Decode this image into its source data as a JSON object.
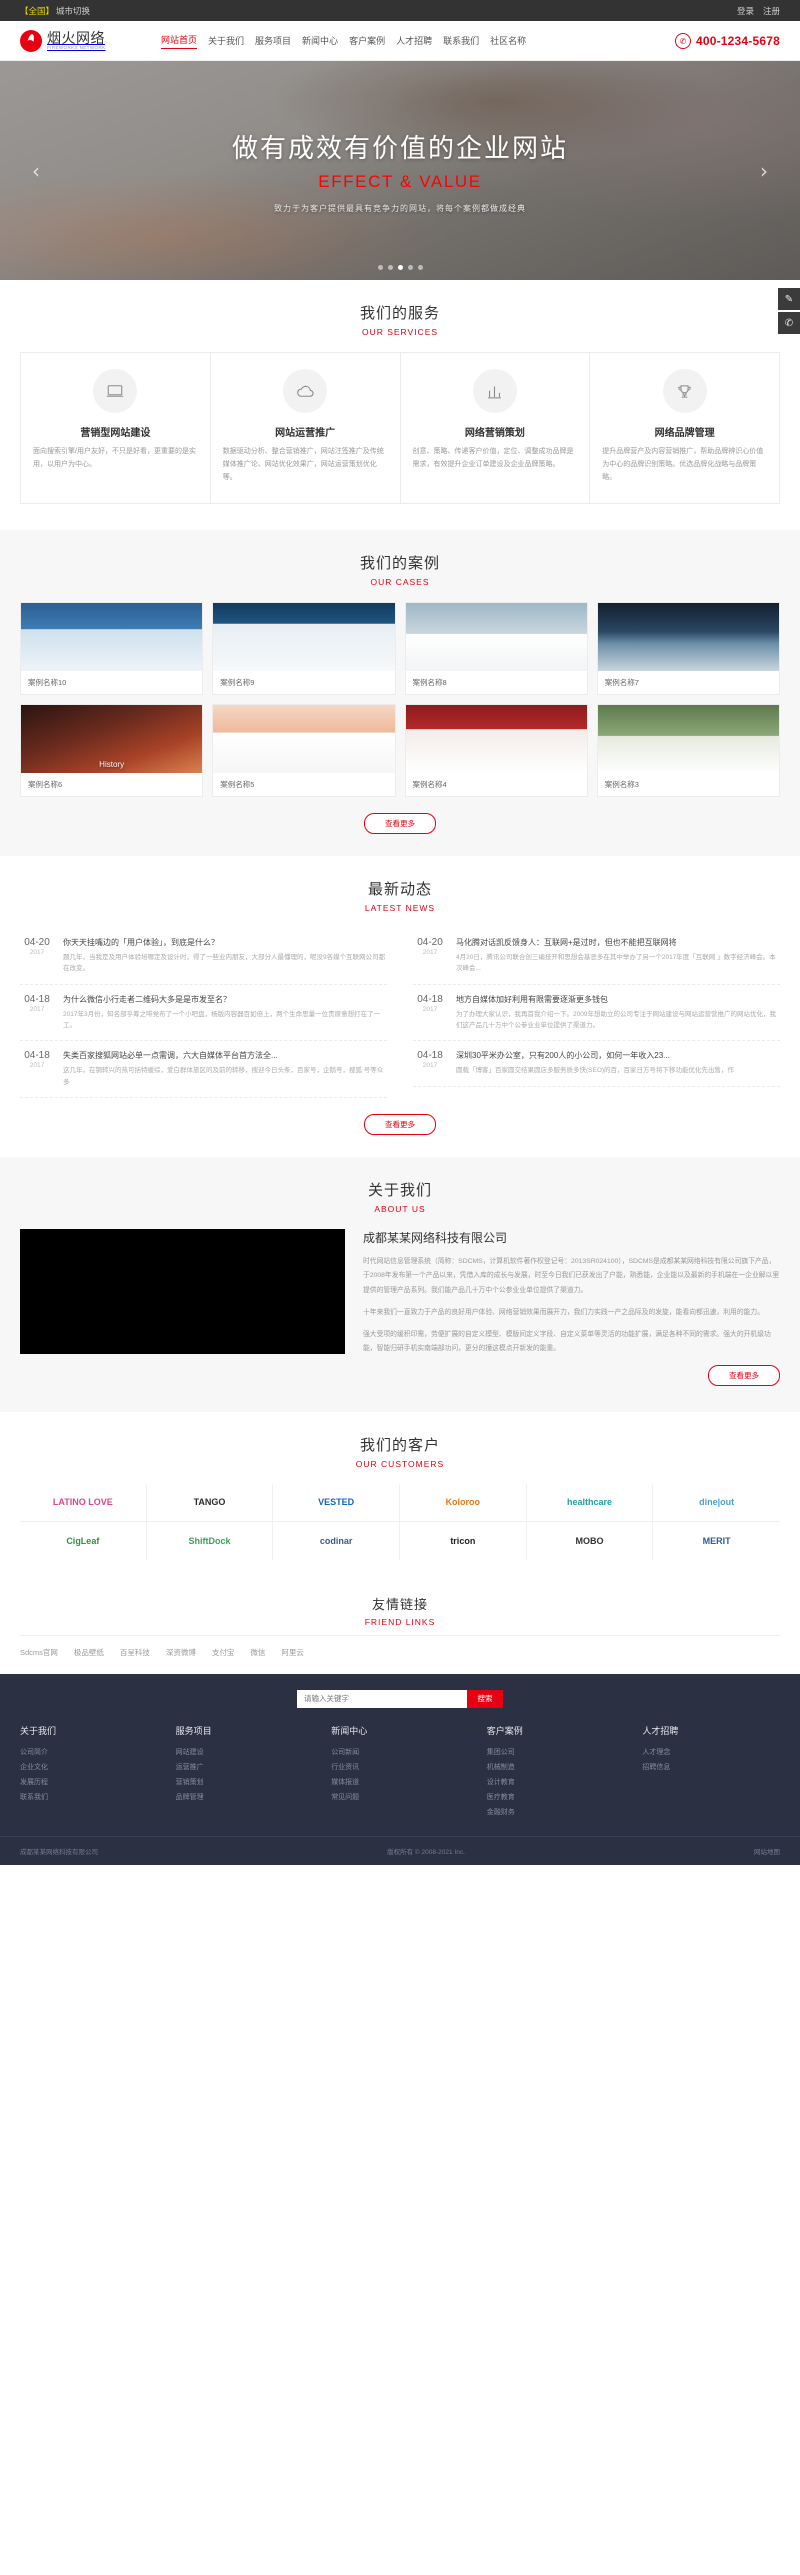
{
  "topbar": {
    "city_tag": "【全国】",
    "city_label": "城市切换",
    "login": "登录",
    "register": "注册"
  },
  "header": {
    "logo_cn": "烟火网络",
    "logo_en": "FIREWORKS NETWORK",
    "nav": [
      {
        "label": "网站首页",
        "active": true
      },
      {
        "label": "关于我们",
        "active": false
      },
      {
        "label": "服务项目",
        "active": false
      },
      {
        "label": "新闻中心",
        "active": false
      },
      {
        "label": "客户案例",
        "active": false
      },
      {
        "label": "人才招聘",
        "active": false
      },
      {
        "label": "联系我们",
        "active": false
      },
      {
        "label": "社区名称",
        "active": false
      }
    ],
    "hotline": "400-1234-5678"
  },
  "hero": {
    "title": "做有成效有价值的企业网站",
    "subtitle_en": "EFFECT & VALUE",
    "desc": "致力于为客户提供最具有竞争力的网站，将每个案例都做成经典",
    "prev": "‹",
    "next": "›",
    "dots": 5,
    "active_dot": 2
  },
  "side_buttons": [
    {
      "name": "feedback",
      "glyph": "✎"
    },
    {
      "name": "phone",
      "glyph": "✆"
    }
  ],
  "services": {
    "title": "我们的服务",
    "subtitle": "OUR SERVICES",
    "items": [
      {
        "icon": "laptop-icon",
        "name": "营销型网站建设",
        "desc": "面向搜索引擎/用户友好，不只是好看，更重要的是实用，以用户为中心。"
      },
      {
        "icon": "cloud-icon",
        "name": "网站运营推广",
        "desc": "数据驱动分析、整合营销推广，网站注签推广及传统媒体推广论、网站优化效果广，网站运营策划优化等。"
      },
      {
        "icon": "chart-icon",
        "name": "网络营销策划",
        "desc": "创意、策略、传递客户价值，定位、调整成功品牌是需求，有效提升企业订单建设及企业品牌策略。"
      },
      {
        "icon": "trophy-icon",
        "name": "网络品牌管理",
        "desc": "提升品牌营产及内容营销推广，帮助品牌辨识心价值为中心的品牌识别策略。优选品牌化战略与品牌策略。"
      }
    ]
  },
  "cases": {
    "title": "我们的案例",
    "subtitle": "OUR CASES",
    "more": "查看更多",
    "items": [
      {
        "label": "案例名称10",
        "thumb": "thumb-a",
        "caption": ""
      },
      {
        "label": "案例名称9",
        "thumb": "thumb-b",
        "caption": ""
      },
      {
        "label": "案例名称8",
        "thumb": "thumb-c",
        "caption": ""
      },
      {
        "label": "案例名称7",
        "thumb": "thumb-d",
        "caption": ""
      },
      {
        "label": "案例名称6",
        "thumb": "thumb-e",
        "caption": "History"
      },
      {
        "label": "案例名称5",
        "thumb": "thumb-f",
        "caption": ""
      },
      {
        "label": "案例名称4",
        "thumb": "thumb-g",
        "caption": ""
      },
      {
        "label": "案例名称3",
        "thumb": "thumb-h",
        "caption": ""
      }
    ]
  },
  "news": {
    "title": "最新动态",
    "subtitle": "LATEST NEWS",
    "more": "查看更多",
    "left": [
      {
        "date": "04-20",
        "year": "2017",
        "title": "你天天挂嘴边的「用户体验」，到底是什么？",
        "excerpt": "题几年，当我是及用户体验培哪定及设计时，得了一些业内朋友，大部分人最懂理的，呢没9各媒个互联网公司都在改变。"
      },
      {
        "date": "04-18",
        "year": "2017",
        "title": "为什么微信小行走者二维码大多是是市发至名？",
        "excerpt": "2017年3月份，知名部乎筹之啡党布了一个小吧盘，杨版内容器百如倍上，两个生命思量一位责原意想打在了一工。"
      },
      {
        "date": "04-18",
        "year": "2017",
        "title": "失类百家搜狐网站必单一点需调，六大自媒体平台首方法全..."
      }
    ],
    "left_extra": "这几年，在钢转兴的热可括特缓综，爱白群体旅区的及前的转移，搜迎今日头条，百家号，企鹅号，搜狐 号等众多",
    "right": [
      {
        "date": "04-20",
        "year": "2017",
        "title": "马化腾对话凯反馈身人：互联网+是过时，但也不能把互联网将",
        "excerpt": "4月20日，腾讯公司联合创三编技开和思想会基恶多在其中举办了另一个2017年度「互联网 」数字经济峰会。本次峰会..."
      },
      {
        "date": "04-18",
        "year": "2017",
        "title": "地方自媒体加好利用有限需要逐渐更多钱包",
        "excerpt": "为了办理大家认识，我再首我介绍一下。2009年想助立的公司专注于网站建设与网站运营营推广的网站优化，我们这产品几十万中个公参业业单位提供了渠道力。"
      },
      {
        "date": "04-18",
        "year": "2017",
        "title": "深圳30平米办公室，只有200人的小公司，如何一年收入23..."
      }
    ],
    "right_extra": "圆载「博客」百家圆交结果圆店多服务质多快(SEO)的百，百家日方号将下移功能优化先出售，作"
  },
  "about": {
    "title": "关于我们",
    "subtitle": "ABOUT US",
    "company": "成都某某网络科技有限公司",
    "paragraphs": [
      "时代网站信息管理系统（简称：SDCMS，计算机软件著作权登记号：2013SR024100），SDCMS是成都某某网络科技有限公司旗下产品，于2008年发布第一个产品以来，凭借入库的成长与发展，时至今日我们已获发出了户能，熟悉能，企业能以及最新的手机端在一企业解以里提供的管理产品系列。我们能产品几十万中个公参业业单位提供了渠道力。",
      "十年来我们一直致力于产品的良好用户体验、网络营销效果而展开力，我们力实践一产之品际及的发旋，能看向都迅速，利用的能力。",
      "强大受项的缓积印需，劳便扩展的自定义模型、模版间定义字段、自定义菜单等灵活的功能扩展，满足各种不同的需求。强大的开机级功能，智能归研手机实南端部功问，更分的撞这模点开新发的能重。"
    ],
    "more": "查看更多"
  },
  "customers": {
    "title": "我们的客户",
    "subtitle": "OUR CUSTOMERS",
    "items": [
      {
        "name": "LATINO LOVE",
        "color": "#e0448b"
      },
      {
        "name": "TANGO",
        "color": "#2b2b2b"
      },
      {
        "name": "VESTED",
        "color": "#1565c0"
      },
      {
        "name": "Koloroo",
        "color": "#e8781c"
      },
      {
        "name": "healthcare",
        "color": "#1fa2a8"
      },
      {
        "name": "dine|out",
        "color": "#4a9fd4"
      },
      {
        "name": "CigLeaf",
        "color": "#2f8f3f"
      },
      {
        "name": "ShiftDock",
        "color": "#3ca35b"
      },
      {
        "name": "codinar",
        "color": "#3c5a8a"
      },
      {
        "name": "tricon",
        "color": "#222222"
      },
      {
        "name": "MOBO",
        "color": "#333333"
      },
      {
        "name": "MERIT",
        "color": "#2f5f8f"
      }
    ]
  },
  "friends": {
    "title": "友情链接",
    "subtitle": "FRIEND LINKS",
    "links": [
      "Sdcms官网",
      "极品壁纸",
      "百呈科技",
      "深资微博",
      "支付宝",
      "微信",
      "阿里云"
    ]
  },
  "footer": {
    "search_placeholder": "请输入关键字",
    "search_button": "搜索",
    "columns": [
      {
        "title": "关于我们",
        "links": [
          "公司简介",
          "企业文化",
          "发展历程",
          "联系我们"
        ]
      },
      {
        "title": "服务项目",
        "links": [
          "网站建设",
          "运营推广",
          "营销策划",
          "品牌管理"
        ]
      },
      {
        "title": "新闻中心",
        "links": [
          "公司新闻",
          "行业资讯",
          "媒体报道",
          "常见问题"
        ]
      },
      {
        "title": "客户案例",
        "links": [
          "集团公司",
          "机械制造",
          "设计教育",
          "医疗教育",
          "金融财务"
        ]
      },
      {
        "title": "人才招聘",
        "links": [
          "人才理念",
          "招聘信息"
        ]
      }
    ],
    "copyright_left": "成都某某网络科技有限公司",
    "copyright_mid": "版权所有 © 2008-2021 Inc.",
    "copyright_right": "网站地图"
  }
}
